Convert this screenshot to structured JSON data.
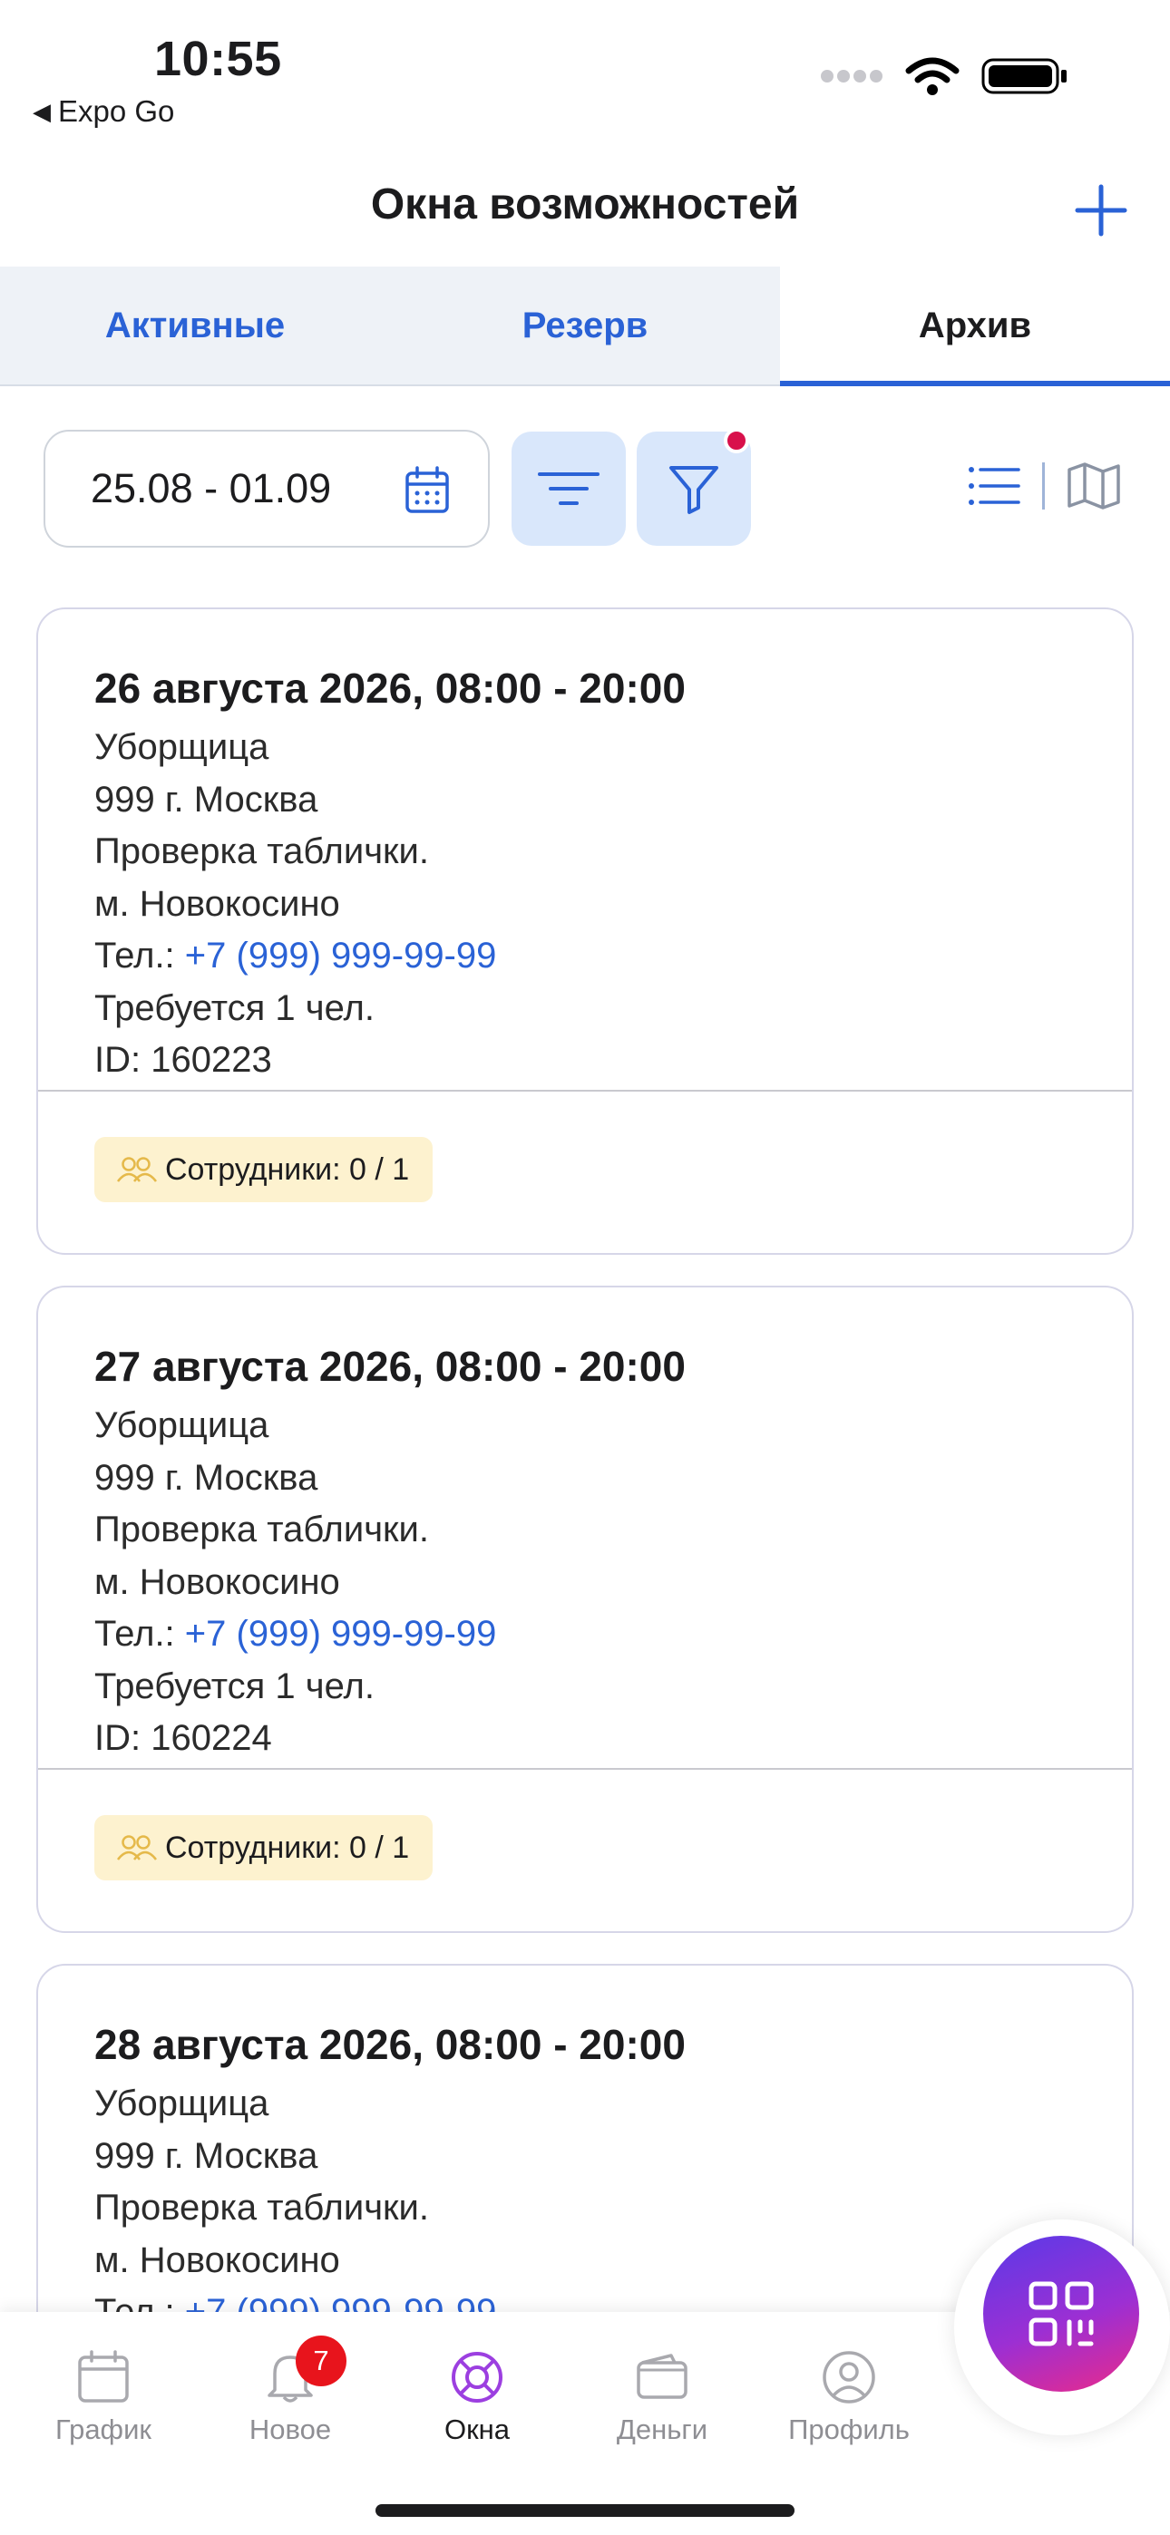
{
  "status_bar": {
    "time": "10:55",
    "back_app": "Expo Go"
  },
  "header": {
    "title": "Окна возможностей"
  },
  "tabs": [
    {
      "label": "Активные",
      "active": false
    },
    {
      "label": "Резерв",
      "active": false
    },
    {
      "label": "Архив",
      "active": true
    }
  ],
  "toolbar": {
    "date_range": "25.08 - 01.09",
    "filter_active": true
  },
  "cards": [
    {
      "date": "26 августа 2026, 08:00 - 20:00",
      "role": "Уборщица",
      "address": "999 г. Москва",
      "note": "Проверка таблички.",
      "metro": "м. Новокосино",
      "phone_label": "Тел.: ",
      "phone": "+7 (999) 999-99-99",
      "required": "Требуется 1 чел.",
      "id": "ID: 160223",
      "staff": "Сотрудники: 0 / 1"
    },
    {
      "date": "27 августа 2026, 08:00 - 20:00",
      "role": "Уборщица",
      "address": "999 г. Москва",
      "note": "Проверка таблички.",
      "metro": "м. Новокосино",
      "phone_label": "Тел.: ",
      "phone": "+7 (999) 999-99-99",
      "required": "Требуется 1 чел.",
      "id": "ID: 160224",
      "staff": "Сотрудники: 0 / 1"
    },
    {
      "date": "28 августа 2026, 08:00 - 20:00",
      "role": "Уборщица",
      "address": "999 г. Москва",
      "note": "Проверка таблички.",
      "metro": "м. Новокосино",
      "phone_label": "Тел.: ",
      "phone": "+7 (999) 999-99-99"
    }
  ],
  "tabbar": {
    "items": [
      {
        "label": "График",
        "icon": "calendar-icon"
      },
      {
        "label": "Новое",
        "icon": "bell-icon",
        "badge": "7"
      },
      {
        "label": "Окна",
        "icon": "lifebuoy-icon",
        "active": true
      },
      {
        "label": "Деньги",
        "icon": "wallet-icon"
      },
      {
        "label": "Профиль",
        "icon": "profile-icon"
      }
    ]
  },
  "colors": {
    "accent": "#2a62d6",
    "badge_red": "#e8141c",
    "staff_badge_bg": "#fdf2cf",
    "fab_gradient_start": "#5a3ae8",
    "fab_gradient_end": "#ea2a8a"
  }
}
